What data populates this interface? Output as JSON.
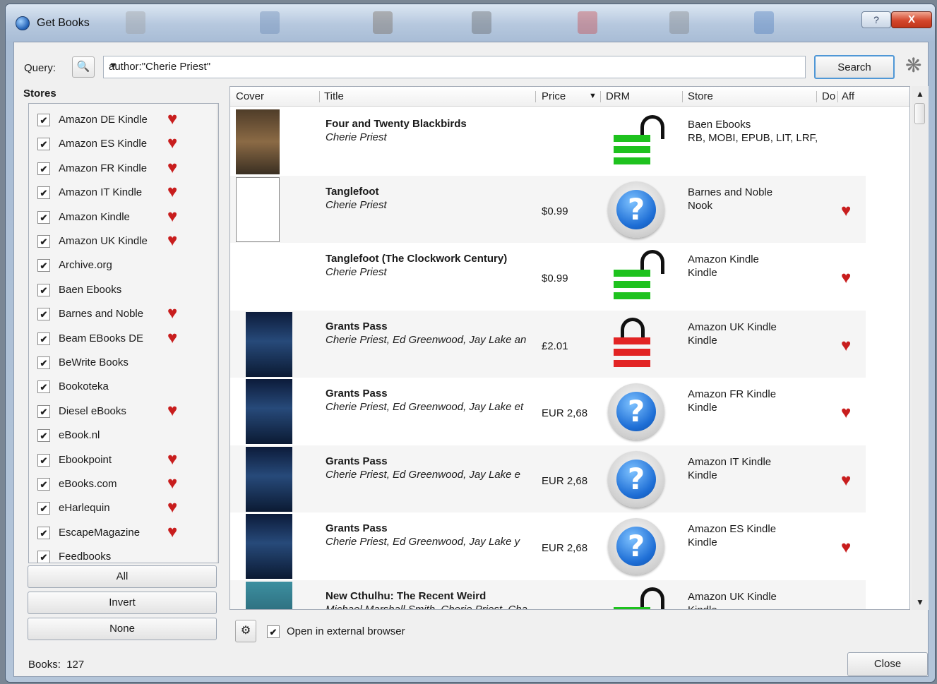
{
  "window": {
    "title": "Get Books",
    "help_label": "?",
    "close_label": "X"
  },
  "query": {
    "label": "Query:",
    "value": "author:\"Cherie Priest\"",
    "binoc_icon": "binoculars-icon",
    "search_label": "Search"
  },
  "stores": {
    "label": "Stores",
    "items": [
      {
        "name": "Amazon DE Kindle",
        "checked": true,
        "affiliate": true
      },
      {
        "name": "Amazon ES Kindle",
        "checked": true,
        "affiliate": true
      },
      {
        "name": "Amazon FR Kindle",
        "checked": true,
        "affiliate": true
      },
      {
        "name": "Amazon IT Kindle",
        "checked": true,
        "affiliate": true
      },
      {
        "name": "Amazon Kindle",
        "checked": true,
        "affiliate": true
      },
      {
        "name": "Amazon UK Kindle",
        "checked": true,
        "affiliate": true
      },
      {
        "name": "Archive.org",
        "checked": true,
        "affiliate": false
      },
      {
        "name": "Baen Ebooks",
        "checked": true,
        "affiliate": false
      },
      {
        "name": "Barnes and Noble",
        "checked": true,
        "affiliate": true
      },
      {
        "name": "Beam EBooks DE",
        "checked": true,
        "affiliate": true
      },
      {
        "name": "BeWrite Books",
        "checked": true,
        "affiliate": false
      },
      {
        "name": "Bookoteka",
        "checked": true,
        "affiliate": false
      },
      {
        "name": "Diesel eBooks",
        "checked": true,
        "affiliate": true
      },
      {
        "name": "eBook.nl",
        "checked": true,
        "affiliate": false
      },
      {
        "name": "Ebookpoint",
        "checked": true,
        "affiliate": true
      },
      {
        "name": "eBooks.com",
        "checked": true,
        "affiliate": true
      },
      {
        "name": "eHarlequin",
        "checked": true,
        "affiliate": true
      },
      {
        "name": "EscapeMagazine",
        "checked": true,
        "affiliate": true
      },
      {
        "name": "Feedbooks",
        "checked": true,
        "affiliate": false
      }
    ],
    "btn_all": "All",
    "btn_invert": "Invert",
    "btn_none": "None"
  },
  "grid": {
    "columns": {
      "cover": "Cover",
      "title": "Title",
      "price": "Price",
      "drm": "DRM",
      "store": "Store",
      "download": "Do",
      "affiliate": "Aff"
    },
    "rows": [
      {
        "title": "Four and Twenty Blackbirds",
        "author": "Cherie Priest",
        "price": "",
        "drm": "unlocked",
        "store": "Baen Ebooks",
        "formats": "RB, MOBI, EPUB, LIT, LRF,",
        "affiliate": false,
        "cover": "brown"
      },
      {
        "title": "Tanglefoot",
        "author": "Cherie Priest",
        "price": "$0.99",
        "drm": "unknown",
        "store": "Barnes and Noble",
        "formats": "Nook",
        "affiliate": true,
        "cover": "plain"
      },
      {
        "title": "Tanglefoot (The Clockwork Century)",
        "author": "Cherie Priest",
        "price": "$0.99",
        "drm": "unlocked",
        "store": "Amazon Kindle",
        "formats": "Kindle",
        "affiliate": true,
        "cover": "none"
      },
      {
        "title": "Grants Pass",
        "author": "Cherie Priest, Ed Greenwood, Jay Lake an",
        "price": "£2.01",
        "drm": "locked",
        "store": "Amazon UK Kindle",
        "formats": "Kindle",
        "affiliate": true,
        "cover": "dark"
      },
      {
        "title": "Grants Pass",
        "author": "Cherie Priest, Ed Greenwood, Jay Lake et",
        "price": "EUR 2,68",
        "drm": "unknown",
        "store": "Amazon FR Kindle",
        "formats": "Kindle",
        "affiliate": true,
        "cover": "dark"
      },
      {
        "title": "Grants Pass",
        "author": "Cherie Priest, Ed Greenwood, Jay Lake e",
        "price": "EUR 2,68",
        "drm": "unknown",
        "store": "Amazon IT Kindle",
        "formats": "Kindle",
        "affiliate": true,
        "cover": "dark"
      },
      {
        "title": "Grants Pass",
        "author": "Cherie Priest, Ed Greenwood, Jay Lake y",
        "price": "EUR 2,68",
        "drm": "unknown",
        "store": "Amazon ES Kindle",
        "formats": "Kindle",
        "affiliate": true,
        "cover": "dark"
      },
      {
        "title": "New Cthulhu: The Recent Weird",
        "author": "Michael Marshall Smith, Cherie Priest, Cha",
        "price": "",
        "drm": "unlocked",
        "store": "Amazon UK Kindle",
        "formats": "Kindle",
        "affiliate": true,
        "cover": "teal"
      }
    ]
  },
  "footer": {
    "open_external_label": "Open in external browser",
    "open_external_checked": true,
    "books_label": "Books:",
    "books_count": "127",
    "close_label": "Close"
  }
}
